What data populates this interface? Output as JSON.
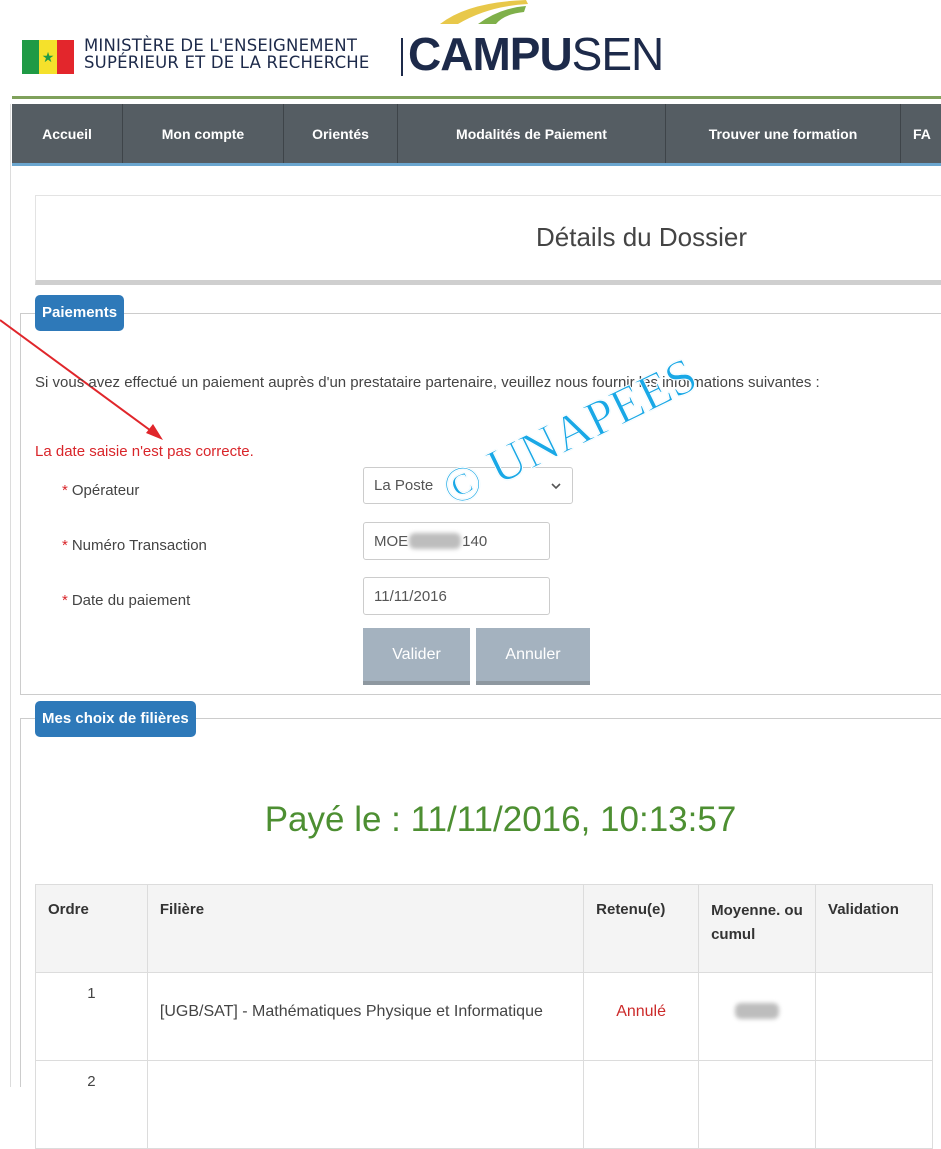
{
  "header": {
    "ministry_line1": "MINISTÈRE DE L'ENSEIGNEMENT",
    "ministry_line2": "SUPÉRIEUR ET DE LA RECHERCHE",
    "logo_bold": "CAMPU",
    "logo_light": "SEN",
    "flag_icon": "senegal-flag-icon"
  },
  "nav": {
    "items": [
      {
        "label": "Accueil"
      },
      {
        "label": "Mon compte"
      },
      {
        "label": "Orientés"
      },
      {
        "label": "Modalités de Paiement"
      },
      {
        "label": "Trouver une formation"
      },
      {
        "label": "FA"
      }
    ]
  },
  "dossier": {
    "title": "Détails du Dossier"
  },
  "payments": {
    "legend": "Paiements",
    "info": "Si vous avez effectué un paiement auprès d'un prestataire partenaire, veuillez nous fournir les informations suivantes :",
    "error": "La date saisie n'est pas correcte.",
    "operator_label": "Opérateur",
    "operator_value": "La Poste",
    "transaction_label": "Numéro Transaction",
    "transaction_prefix": "MOE",
    "transaction_suffix": "140",
    "date_label": "Date du paiement",
    "date_value": "11/11/2016",
    "validate_label": "Valider",
    "cancel_label": "Annuler",
    "required_mark": "*"
  },
  "watermark": "© UNAPEES",
  "choices": {
    "legend": "Mes choix de filières",
    "paid_text": "Payé le : 11/11/2016, 10:13:57",
    "columns": [
      "Ordre",
      "Filière",
      "Retenu(e)",
      "Moyenne. ou cumul",
      "Validation"
    ],
    "rows": [
      {
        "ordre": "1",
        "filiere": "[UGB/SAT] - Mathématiques Physique et Informatique",
        "retenu": "Annulé",
        "moyenne": "",
        "validation": ""
      },
      {
        "ordre": "2",
        "filiere": "",
        "retenu": "",
        "moyenne": "",
        "validation": ""
      }
    ]
  },
  "colors": {
    "nav_bg": "#555d63",
    "legend_bg": "#2e79b9",
    "error": "#d9252a",
    "paid": "#4d8f32",
    "watermark": "#19a8e6",
    "button": "#a4b2bf"
  }
}
